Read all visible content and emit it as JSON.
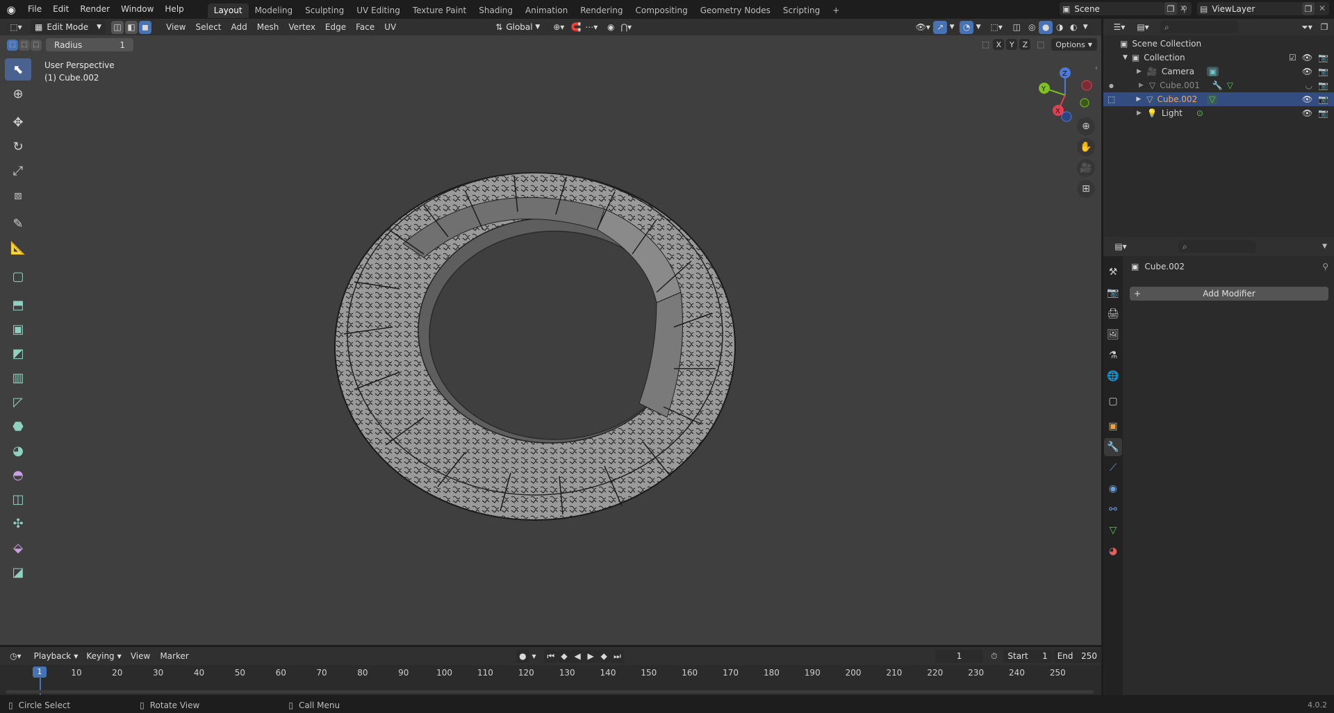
{
  "menu": {
    "items": [
      "File",
      "Edit",
      "Render",
      "Window",
      "Help"
    ],
    "workspaces": [
      "Layout",
      "Modeling",
      "Sculpting",
      "UV Editing",
      "Texture Paint",
      "Shading",
      "Animation",
      "Rendering",
      "Compositing",
      "Geometry Nodes",
      "Scripting"
    ],
    "active_workspace": "Layout",
    "add_tab": "+",
    "scene": "Scene",
    "view_layer": "ViewLayer"
  },
  "viewport": {
    "mode": "Edit Mode",
    "menus": [
      "View",
      "Select",
      "Add",
      "Mesh",
      "Vertex",
      "Edge",
      "Face",
      "UV"
    ],
    "orientation": "Global",
    "radius_label": "Radius",
    "radius_value": "1",
    "axes": [
      "X",
      "Y",
      "Z"
    ],
    "options": "Options",
    "overlay_title": "User Perspective",
    "overlay_object": "(1) Cube.002",
    "gizmo": {
      "x": "X",
      "y": "Y",
      "z": "Z"
    }
  },
  "outliner": {
    "scene_collection": "Scene Collection",
    "collection": "Collection",
    "objects": [
      {
        "name": "Camera",
        "color": "#e8a04b"
      },
      {
        "name": "Cube.001",
        "color": "#8a8a8a"
      },
      {
        "name": "Cube.002",
        "color": "#f0a860"
      },
      {
        "name": "Light",
        "color": "#e8a04b"
      }
    ],
    "selected": "Cube.002"
  },
  "properties": {
    "object_name": "Cube.002",
    "add_modifier": "Add Modifier",
    "add_icon": "+"
  },
  "timeline": {
    "menus": [
      "Playback",
      "Keying",
      "View",
      "Marker"
    ],
    "current_frame": "1",
    "start_label": "Start",
    "start_value": "1",
    "end_label": "End",
    "end_value": "250",
    "ticks": [
      "10",
      "20",
      "30",
      "40",
      "50",
      "60",
      "70",
      "80",
      "90",
      "100",
      "110",
      "120",
      "130",
      "140",
      "150",
      "160",
      "170",
      "180",
      "190",
      "200",
      "210",
      "220",
      "230",
      "240",
      "250"
    ],
    "playhead": "1"
  },
  "status": {
    "items": [
      "Circle Select",
      "Rotate View",
      "Call Menu"
    ],
    "version": "4.0.2"
  },
  "colors": {
    "accent": "#4772b3",
    "selection": "#334d80",
    "viewport_bg": "#3f3f3f"
  }
}
